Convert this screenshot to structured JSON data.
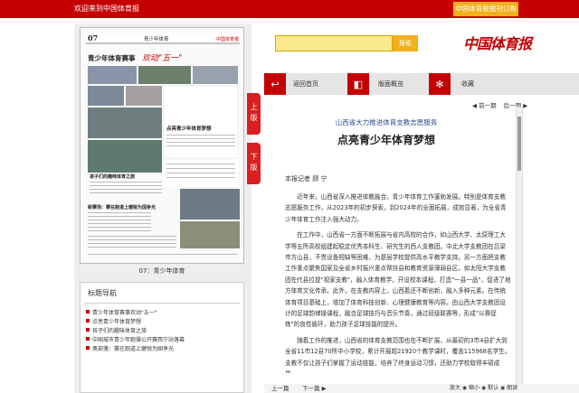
{
  "topbar": {
    "welcome": "欢迎来到中国体育报",
    "subscribe": "中国体育报报刊订购"
  },
  "newspaper": {
    "issue": "07",
    "section_header": "青少年体育",
    "headline_top": "青少年体育赛事",
    "headline_highlight": "欢动\"五一\"",
    "article2_title": "点亮青少年体育梦想",
    "article3_title": "孩子们的趣味体育之旅",
    "article4_title": "新赛场：赛在跑道上健锐为国争光",
    "page_caption": "07：青少年体育"
  },
  "nav": {
    "title": "标题导航",
    "items": [
      "青少年体育赛事欢动\"五一\"",
      "点亮青少年体育梦想",
      "孩子们的趣味体育之旅",
      "中国城市青少年跑操公开赛西宁站落幕",
      "奥部落：赛在跑道上健锐为国争光"
    ]
  },
  "page_tabs": {
    "prev": "上版",
    "next": "下版"
  },
  "search": {
    "placeholder": "",
    "button": "搜索"
  },
  "logo": "中国体育报",
  "toolbar": {
    "home": "返回首页",
    "overview": "版面概览",
    "favorite": "收藏"
  },
  "article": {
    "prev": "◀ 前一期",
    "next": "后一期 ▶",
    "kicker": "山西省大力推进体育支教志愿服务",
    "title": "点亮青少年体育梦想",
    "byline": "本报记者  顾 宁",
    "paragraphs": [
      "近年来，山西省深入推进体教融合，青少年体育工作蓬勃发展。特别是体育支教志愿服务工作，从2023年的初步探索，到2024年的全面拓展，成效显著，为全省青少年体育工作注入强大动力。",
      "在工作中，山西省一方面不断拓展与省内高校的合作，如山西大学、太原理工大学等五所高校组建起稳定优秀本科生、研究生的西人支教团。中北大学支教团在吕梁市方山县，不畏设备短缺等困难，为基层学校提供高水平教学支持。另一方面把支教工作重点聚焦国家及全省乡村振兴重点帮扶县和教育资源薄弱县区。如太阳大学支教团在代县拉提\"视家支教\"，融入体育教学，开设校本课程，打造\"一县一品\"，促进了地方体育文化传承。此外，在支教内容上，山西着还不断创新，融入多种元素。在传统体育项目基础上，增加了体育科技创新、心理健康教育等内容。由山西大学支教团设计的足球韵律操课程，融合足球技巧与音乐节奏，通过班级联赛等，形成\"以赛促练\"的良性循环，助力孩子足球技能的提升。",
      "随着工作的推进，山西省的体育支教范围也在不断扩展，从最初的3市4县扩大到全省11市12县70所中小学校，累计开展超21920个教学课时，覆盖115968名学生。支教不仅让孩子们掌握了运动技能，培养了终身运动习惯，还助力学校取得丰硕成果。"
    ],
    "prev_article": "上一篇",
    "next_article": "下一篇 ▶",
    "zoom": "放大 ◉ 缩小 ◉ 默认 ◉ 朗读"
  },
  "colors": {
    "brand_red": "#c40000",
    "accent_orange": "#f2b01b"
  }
}
